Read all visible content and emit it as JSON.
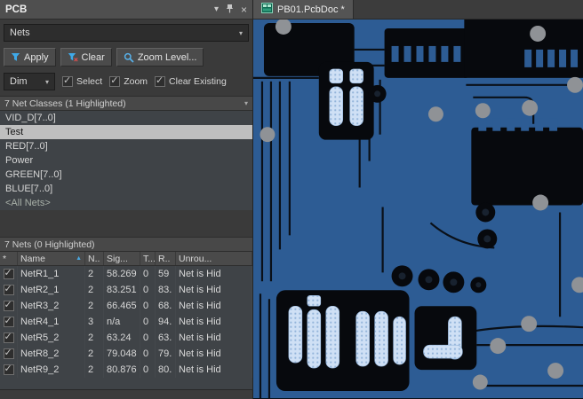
{
  "icons": {
    "dropdown": "▾",
    "close": "×",
    "check": "✓",
    "sort_asc": "▲"
  },
  "colors": {
    "pour_blue": "#2d5c94",
    "board_dark": "#07090d",
    "gap_dark": "#0a1018",
    "via_gray": "#8f9296",
    "pad_highlight": "#cfe0f5",
    "pad_dot": "#93b4da",
    "selection_bg": "#bfbfbf",
    "accent_blue": "#4aa8e0"
  },
  "panel": {
    "title": "PCB",
    "mode_select": "Nets",
    "toolbar": {
      "apply_label": "Apply",
      "clear_label": "Clear",
      "zoom_label": "Zoom Level..."
    },
    "dim_row": {
      "dim_label": "Dim",
      "checkboxes": [
        {
          "label": "Select",
          "checked": true
        },
        {
          "label": "Zoom",
          "checked": true
        },
        {
          "label": "Clear Existing",
          "checked": true
        }
      ]
    },
    "net_classes": {
      "header": "7 Net Classes (1 Highlighted)",
      "items": [
        {
          "label": "VID_D[7..0]",
          "selected": false
        },
        {
          "label": "Test",
          "selected": true
        },
        {
          "label": "RED[7..0]",
          "selected": false
        },
        {
          "label": "Power",
          "selected": false
        },
        {
          "label": "GREEN[7..0]",
          "selected": false
        },
        {
          "label": "BLUE[7..0]",
          "selected": false
        },
        {
          "label": "<All Nets>",
          "selected": false
        }
      ]
    },
    "nets": {
      "header": "7 Nets (0 Highlighted)",
      "columns": [
        "*",
        "Name",
        "N..",
        "Sig...",
        "T...",
        "R..",
        "Unrou..."
      ],
      "rows": [
        {
          "checked": true,
          "name": "NetR1_1",
          "nodes": "2",
          "signal": "58.269",
          "t": "0",
          "routed": "59",
          "unrouted": "Net is Hid"
        },
        {
          "checked": true,
          "name": "NetR2_1",
          "nodes": "2",
          "signal": "83.251",
          "t": "0",
          "routed": "83.",
          "unrouted": "Net is Hid"
        },
        {
          "checked": true,
          "name": "NetR3_2",
          "nodes": "2",
          "signal": "66.465",
          "t": "0",
          "routed": "68.",
          "unrouted": "Net is Hid"
        },
        {
          "checked": true,
          "name": "NetR4_1",
          "nodes": "3",
          "signal": "n/a",
          "t": "0",
          "routed": "94.",
          "unrouted": "Net is Hid"
        },
        {
          "checked": true,
          "name": "NetR5_2",
          "nodes": "2",
          "signal": "63.24",
          "t": "0",
          "routed": "63.",
          "unrouted": "Net is Hid"
        },
        {
          "checked": true,
          "name": "NetR8_2",
          "nodes": "2",
          "signal": "79.048",
          "t": "0",
          "routed": "79.",
          "unrouted": "Net is Hid"
        },
        {
          "checked": true,
          "name": "NetR9_2",
          "nodes": "2",
          "signal": "80.876",
          "t": "0",
          "routed": "80.",
          "unrouted": "Net is Hid"
        }
      ]
    }
  },
  "editor": {
    "tab_label": "PB01.PcbDoc *"
  }
}
